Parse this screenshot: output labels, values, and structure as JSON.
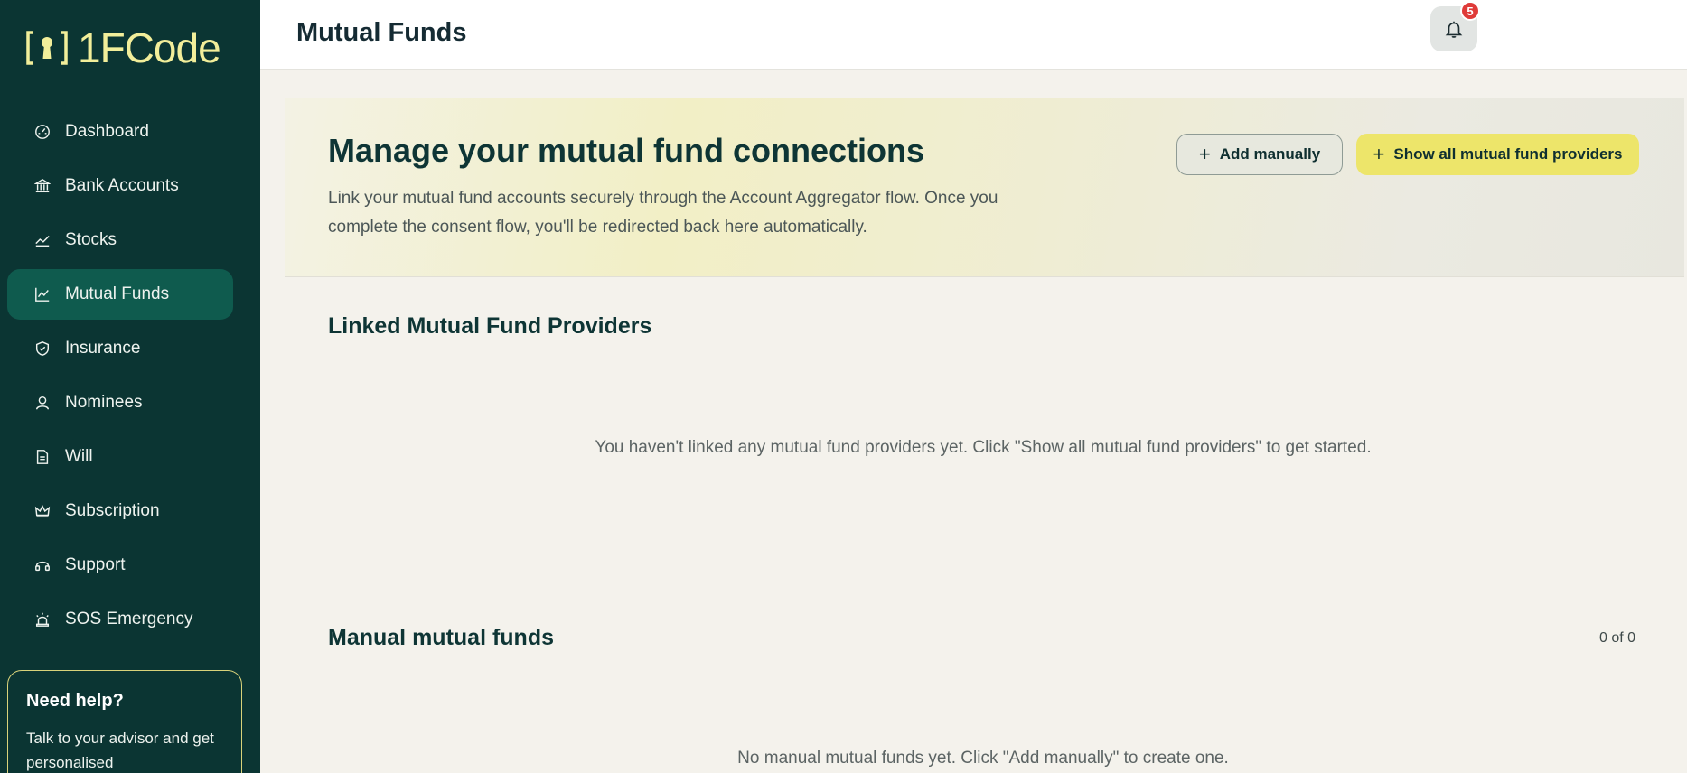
{
  "brand": {
    "name": "1FCode",
    "accent": "#f2ee9a",
    "sidebar_bg": "#0b3533",
    "active_bg": "#0f5b4e"
  },
  "sidebar": {
    "items": [
      {
        "label": "Dashboard",
        "icon": "dashboard-gauge-icon"
      },
      {
        "label": "Bank Accounts",
        "icon": "bank-icon"
      },
      {
        "label": "Stocks",
        "icon": "trend-line-icon"
      },
      {
        "label": "Mutual Funds",
        "icon": "line-chart-icon",
        "active": true
      },
      {
        "label": "Insurance",
        "icon": "shield-check-icon"
      },
      {
        "label": "Nominees",
        "icon": "user-icon"
      },
      {
        "label": "Will",
        "icon": "document-icon"
      },
      {
        "label": "Subscription",
        "icon": "crown-icon"
      },
      {
        "label": "Support",
        "icon": "headset-icon"
      },
      {
        "label": "SOS Emergency",
        "icon": "alarm-siren-icon"
      }
    ],
    "help": {
      "title": "Need help?",
      "text": "Talk to your advisor and get personalised"
    }
  },
  "header": {
    "title": "Mutual Funds",
    "notifications_count": "5"
  },
  "hero": {
    "title": "Manage your mutual fund connections",
    "description": "Link your mutual fund accounts securely through the Account Aggregator flow. Once you complete the consent flow, you'll be redirected back here automatically.",
    "add_manually_label": "Add manually",
    "show_providers_label": "Show all mutual fund providers"
  },
  "linked": {
    "title": "Linked Mutual Fund Providers",
    "empty_text": "You haven't linked any mutual fund providers yet. Click \"Show all mutual fund providers\" to get started."
  },
  "manual": {
    "title": "Manual mutual funds",
    "count": "0 of 0",
    "empty_text": "No manual mutual funds yet. Click \"Add manually\" to create one."
  }
}
